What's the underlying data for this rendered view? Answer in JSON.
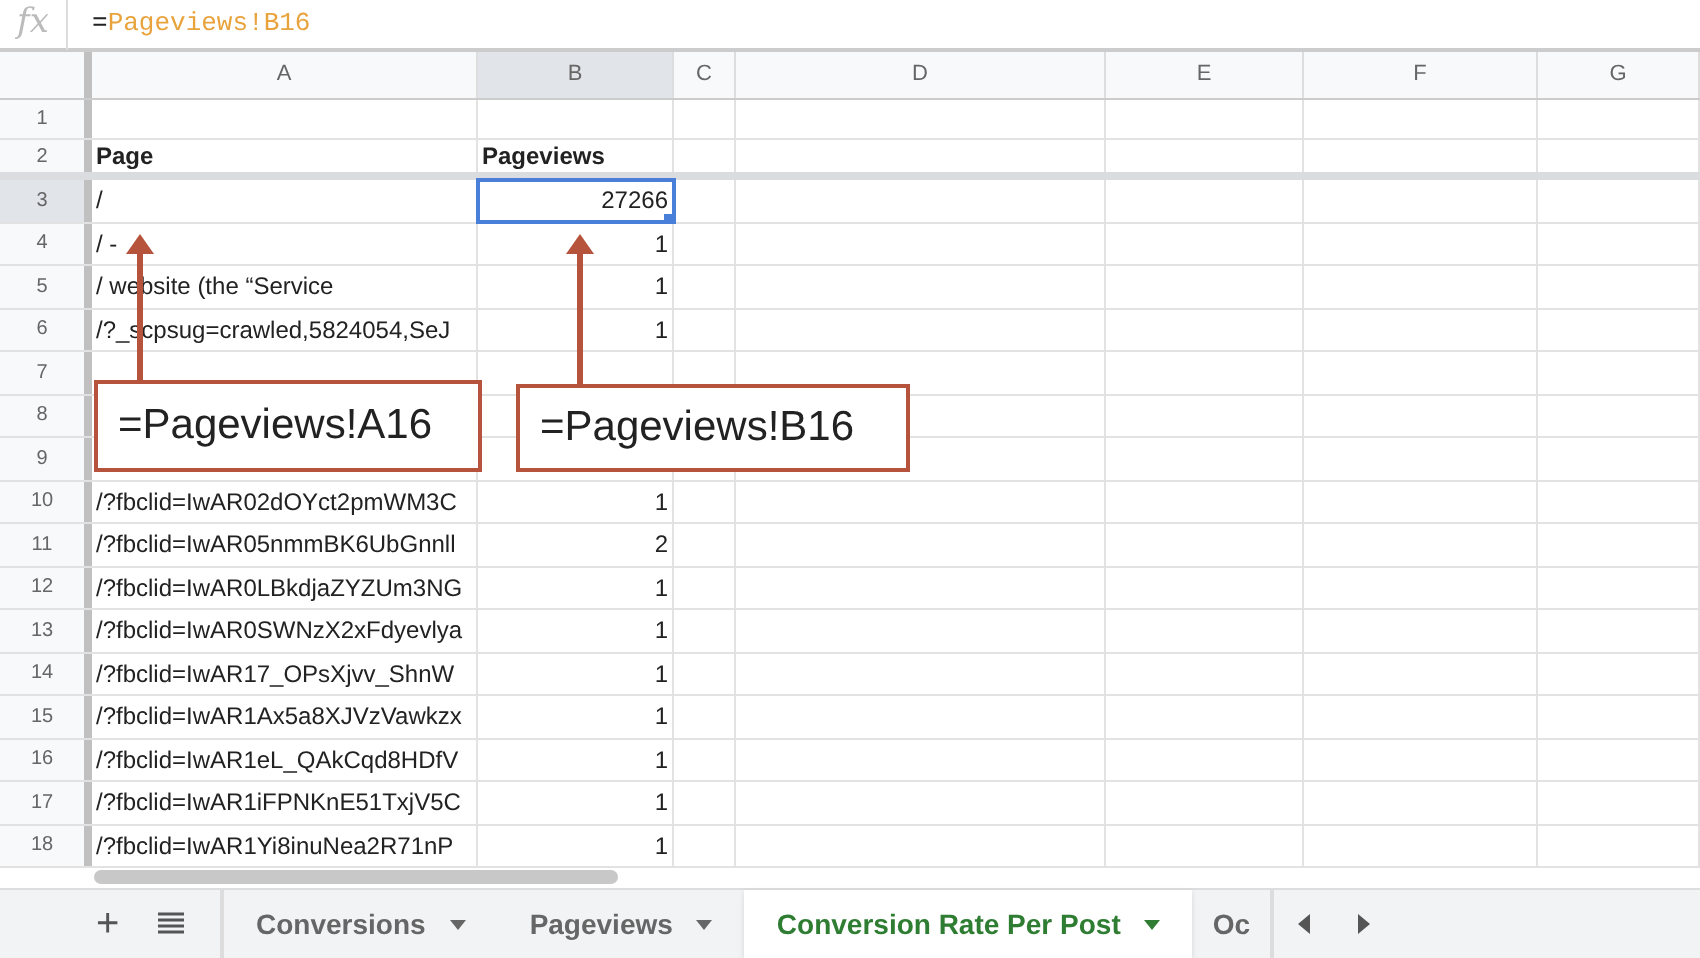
{
  "formula_bar": {
    "label": "fx",
    "operator": "=",
    "reference": "Pageviews!B16"
  },
  "columns": [
    {
      "label": "A",
      "selected": false
    },
    {
      "label": "B",
      "selected": true
    },
    {
      "label": "C",
      "selected": false
    },
    {
      "label": "D",
      "selected": false
    },
    {
      "label": "E",
      "selected": false
    },
    {
      "label": "F",
      "selected": false
    },
    {
      "label": "G",
      "selected": false
    }
  ],
  "rows": [
    {
      "number": "1",
      "kind": "blank",
      "selected": false
    },
    {
      "number": "2",
      "kind": "header",
      "selected": false,
      "a": "Page",
      "b": "Pageviews"
    },
    {
      "number": "3",
      "kind": "data",
      "selected": true,
      "a": "/",
      "b": "27266"
    },
    {
      "number": "4",
      "kind": "data",
      "selected": false,
      "a": "/ -",
      "b": "1"
    },
    {
      "number": "5",
      "kind": "data",
      "selected": false,
      "a": "/ website (the “Service",
      "b": "1"
    },
    {
      "number": "6",
      "kind": "data",
      "selected": false,
      "a": "/?_scpsug=crawled,5824054,SeJ",
      "b": "1"
    },
    {
      "number": "7",
      "kind": "blank",
      "selected": false
    },
    {
      "number": "8",
      "kind": "blank",
      "selected": false
    },
    {
      "number": "9",
      "kind": "blank",
      "selected": false
    },
    {
      "number": "10",
      "kind": "data",
      "selected": false,
      "a": "/?fbclid=IwAR02dOYct2pmWM3C",
      "b": "1"
    },
    {
      "number": "11",
      "kind": "data",
      "selected": false,
      "a": "/?fbclid=IwAR05nmmBK6UbGnnll",
      "b": "2"
    },
    {
      "number": "12",
      "kind": "data",
      "selected": false,
      "a": "/?fbclid=IwAR0LBkdjaZYZUm3NG",
      "b": "1"
    },
    {
      "number": "13",
      "kind": "data",
      "selected": false,
      "a": "/?fbclid=IwAR0SWNzX2xFdyevlya",
      "b": "1"
    },
    {
      "number": "14",
      "kind": "data",
      "selected": false,
      "a": "/?fbclid=IwAR17_OPsXjvv_ShnW",
      "b": "1"
    },
    {
      "number": "15",
      "kind": "data",
      "selected": false,
      "a": "/?fbclid=IwAR1Ax5a8XJVzVawkzx",
      "b": "1"
    },
    {
      "number": "16",
      "kind": "data",
      "selected": false,
      "a": "/?fbclid=IwAR1eL_QAkCqd8HDfV",
      "b": "1"
    },
    {
      "number": "17",
      "kind": "data",
      "selected": false,
      "a": "/?fbclid=IwAR1iFPNKnE51TxjV5C",
      "b": "1"
    },
    {
      "number": "18",
      "kind": "data",
      "selected": false,
      "a": "/?fbclid=IwAR1Yi8inuNea2R71nP",
      "b": "1"
    }
  ],
  "add_sheet": "+",
  "callouts": [
    "=Pageviews!A16",
    "=Pageviews!B16"
  ],
  "sheet_tabs": [
    {
      "label": "Conversions",
      "selected": false
    },
    {
      "label": "Pageviews",
      "selected": false
    },
    {
      "label": "Conversion Rate Per Post",
      "selected": true
    },
    {
      "label": "Oc",
      "selected": false
    }
  ]
}
